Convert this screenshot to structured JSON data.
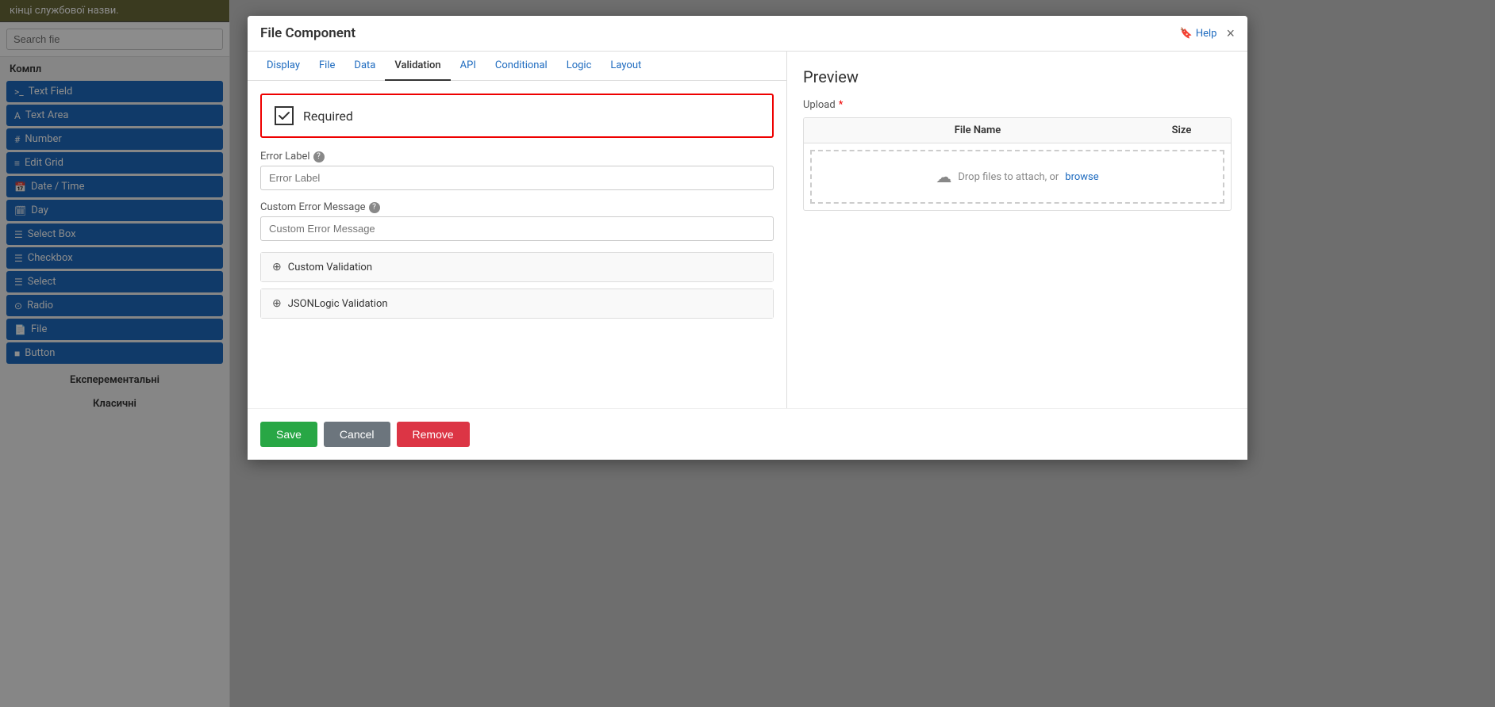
{
  "sidebar": {
    "header_text": "кінці службової назви.",
    "search_placeholder": "Search fie",
    "label_text": "Компл",
    "buttons": [
      {
        "id": "text-field",
        "icon": ">_",
        "label": "Text Field"
      },
      {
        "id": "text-area",
        "icon": "A",
        "label": "Text Area"
      },
      {
        "id": "number",
        "icon": "#",
        "label": "Number"
      },
      {
        "id": "edit-grid",
        "icon": "≡",
        "label": "Edit Grid"
      },
      {
        "id": "date-time",
        "icon": "📅",
        "label": "Date / Time"
      },
      {
        "id": "day",
        "icon": "🗓",
        "label": "Day"
      },
      {
        "id": "select-box",
        "icon": "☰",
        "label": "Select Box"
      },
      {
        "id": "checkbox",
        "icon": "☰",
        "label": "Checkbox"
      },
      {
        "id": "select",
        "icon": "☰",
        "label": "Select"
      },
      {
        "id": "radio",
        "icon": "⊙",
        "label": "Radio"
      },
      {
        "id": "file",
        "icon": "📄",
        "label": "File"
      },
      {
        "id": "button",
        "icon": "■",
        "label": "Button"
      }
    ],
    "section_experimental": "Експерементальні",
    "section_classic": "Класичні"
  },
  "modal": {
    "title": "File Component",
    "help_label": "Help",
    "close_label": "×",
    "tabs": [
      {
        "id": "display",
        "label": "Display",
        "active": false
      },
      {
        "id": "file",
        "label": "File",
        "active": false
      },
      {
        "id": "data",
        "label": "Data",
        "active": false
      },
      {
        "id": "validation",
        "label": "Validation",
        "active": true
      },
      {
        "id": "api",
        "label": "API",
        "active": false
      },
      {
        "id": "conditional",
        "label": "Conditional",
        "active": false
      },
      {
        "id": "logic",
        "label": "Logic",
        "active": false
      },
      {
        "id": "layout",
        "label": "Layout",
        "active": false
      }
    ],
    "required_label": "Required",
    "error_label_field": {
      "label": "Error Label",
      "placeholder": "Error Label"
    },
    "custom_error_field": {
      "label": "Custom Error Message",
      "placeholder": "Custom Error Message"
    },
    "custom_validation_label": "Custom Validation",
    "json_logic_label": "JSONLogic Validation",
    "preview": {
      "title": "Preview",
      "upload_label": "Upload",
      "required": true,
      "table_col_name": "File Name",
      "table_col_size": "Size",
      "drop_text": "Drop files to attach, or",
      "browse_text": "browse"
    },
    "buttons": {
      "save": "Save",
      "cancel": "Cancel",
      "remove": "Remove"
    }
  }
}
